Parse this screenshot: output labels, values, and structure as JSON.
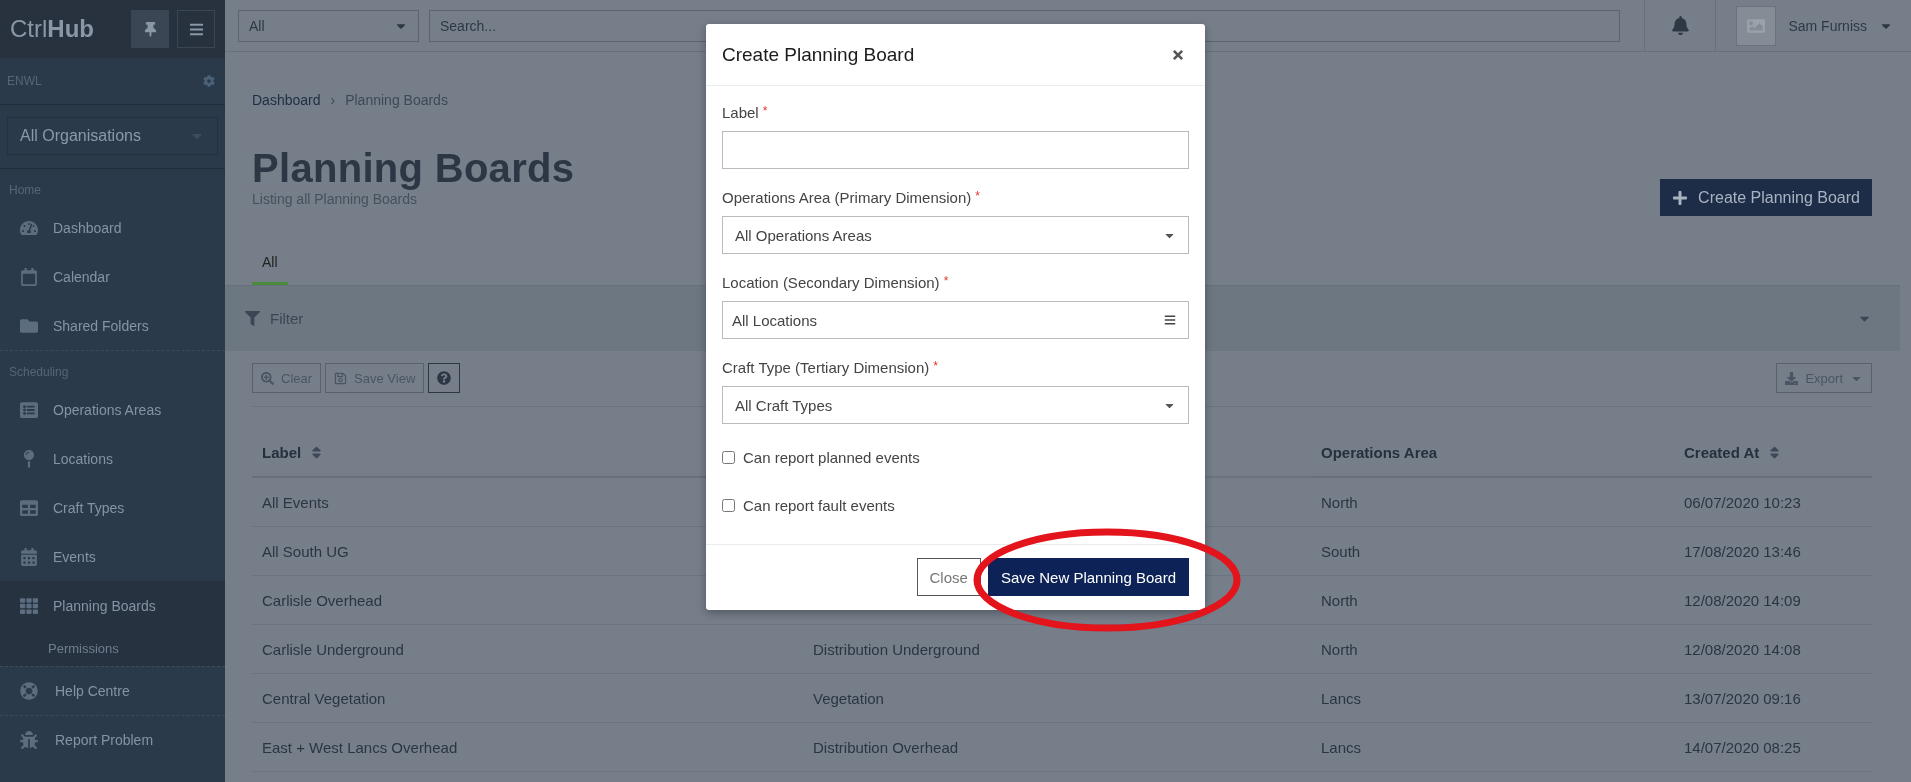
{
  "sidebar": {
    "logo": "Ctrl**Hub**",
    "org_label": "ENWL",
    "org_select": "All Organisations",
    "sections": [
      {
        "heading": "Home",
        "items": [
          {
            "label": "Dashboard",
            "kind": "dashboard",
            "selected": false
          },
          {
            "label": "Calendar",
            "kind": "calendar",
            "selected": false
          },
          {
            "label": "Shared Folders",
            "kind": "folder",
            "selected": false
          }
        ]
      },
      {
        "heading": "Scheduling",
        "items": [
          {
            "label": "Operations Areas",
            "kind": "list",
            "selected": false
          },
          {
            "label": "Locations",
            "kind": "pin",
            "selected": false
          },
          {
            "label": "Craft Types",
            "kind": "table",
            "selected": false
          },
          {
            "label": "Events",
            "kind": "events",
            "selected": false
          },
          {
            "label": "Planning Boards",
            "kind": "grid",
            "selected": true,
            "children": [
              {
                "label": "Permissions",
                "selected": false
              }
            ]
          }
        ]
      }
    ],
    "footer_items": [
      {
        "label": "Help Centre",
        "kind": "help",
        "selected": false
      },
      {
        "label": "Report Problem",
        "kind": "bug",
        "selected": false
      }
    ]
  },
  "topbar": {
    "scope_select": "All",
    "search_placeholder": "Search...",
    "user_name": "Sam Furniss"
  },
  "page": {
    "breadcrumb": [
      "Dashboard",
      "Planning Boards"
    ],
    "breadcrumb_separator": "›",
    "title": "Planning Boards",
    "subtitle": "Listing all Planning Boards",
    "create_button": "Create Planning Board",
    "tabs": [
      {
        "label": "All",
        "selected": true
      }
    ],
    "filter": "Filter",
    "toolbar": [
      {
        "label": "Clear",
        "kind": "clear"
      },
      {
        "label": "Save View",
        "kind": "save"
      },
      {
        "kind": "help"
      }
    ],
    "export": "Export",
    "table": {
      "columns": [
        {
          "title": "Label",
          "sortable": true
        },
        null,
        {
          "title": "Operations Area",
          "sortable": false
        },
        {
          "title": "Created At",
          "sortable": true
        }
      ],
      "rows": [
        {
          "cells": [
            "All Events",
            null,
            "North",
            "06/07/2020 10:23"
          ]
        },
        {
          "cells": [
            "All South UG",
            null,
            "South",
            "17/08/2020 13:46"
          ]
        },
        {
          "cells": [
            "Carlisle Overhead",
            null,
            "North",
            "12/08/2020 14:09"
          ]
        },
        {
          "cells": [
            "Carlisle Underground",
            "Distribution Underground",
            "North",
            "12/08/2020 14:08"
          ]
        },
        {
          "cells": [
            "Central Vegetation",
            "Vegetation",
            "Lancs",
            "13/07/2020 09:16"
          ]
        },
        {
          "cells": [
            "East + West Lancs Overhead",
            "Distribution Overhead",
            "Lancs",
            "14/07/2020 08:25"
          ]
        }
      ]
    }
  },
  "modal": {
    "title": "Create Planning Board",
    "fields": [
      {
        "kind": "text",
        "label": "Label",
        "required_mark": "*"
      },
      {
        "kind": "select",
        "label": "Operations Area (Primary Dimension)",
        "required_mark": "*",
        "value": "All Operations Areas"
      },
      {
        "kind": "multi",
        "label": "Location (Secondary Dimension)",
        "required_mark": "*",
        "value": "All Locations"
      },
      {
        "kind": "select",
        "label": "Craft Type (Tertiary Dimension)",
        "required_mark": "*",
        "value": "All Craft Types"
      }
    ],
    "checkboxes": [
      {
        "label": "Can report planned events",
        "checked": false
      },
      {
        "label": "Can report fault events",
        "checked": false
      }
    ],
    "buttons": [
      {
        "label": "Close",
        "kind": "secondary"
      },
      {
        "label": "Save New Planning Board",
        "kind": "primary"
      }
    ]
  },
  "annotation": {
    "kind": "ellipse"
  }
}
